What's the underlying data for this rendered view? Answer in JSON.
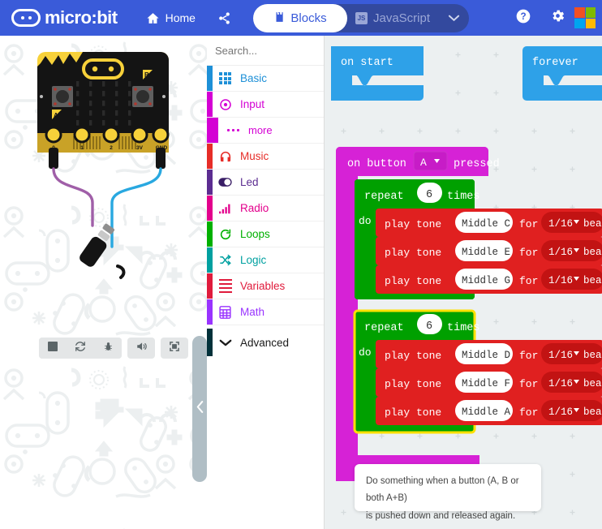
{
  "app": {
    "brand": "micro:bit",
    "brand_icon": "microbit-logo-icon"
  },
  "topbar": {
    "home_label": "Home",
    "home_icon": "home-icon",
    "share_icon": "share-icon",
    "toggle": {
      "blocks_label": "Blocks",
      "blocks_icon": "puzzle-piece-icon",
      "javascript_label": "JavaScript",
      "javascript_badge": "JS",
      "caret_icon": "chevron-down-icon",
      "selected": "Blocks"
    },
    "help_icon": "help-circle-icon",
    "settings_icon": "gear-icon",
    "ms_logo_icon": "microsoft-logo-icon",
    "ms_logo_colors": [
      "#f25022",
      "#7fba00",
      "#00a4ef",
      "#ffb900"
    ],
    "background": "#3a5bd9"
  },
  "simulator": {
    "device": "micro:bit board",
    "pin_labels": [
      "0",
      "1",
      "2",
      "3V",
      "GND"
    ],
    "accessory": "headphone-jack-with-wires",
    "wire_colors": [
      "#a05fa8",
      "#29a8e0"
    ],
    "toolbar": [
      {
        "name": "stop-button",
        "icon": "stop-square-icon"
      },
      {
        "name": "restart-button",
        "icon": "refresh-icon"
      },
      {
        "name": "debug-button",
        "icon": "bug-icon"
      },
      {
        "name": "mute-button",
        "icon": "speaker-icon"
      },
      {
        "name": "fullscreen-button",
        "icon": "fullscreen-icon"
      }
    ],
    "collapse_handle_icon": "chevron-left-icon"
  },
  "toolbox": {
    "search": {
      "placeholder": "Search...",
      "value": "",
      "icon": "search-icon"
    },
    "categories": [
      {
        "label": "Basic",
        "color": "#1e90d7",
        "icon": "grid-dots-icon",
        "sub": false
      },
      {
        "label": "Input",
        "color": "#d400d4",
        "icon": "target-icon",
        "sub": false
      },
      {
        "label": "more",
        "color": "#d400d4",
        "icon": "ellipsis-icon",
        "sub": true
      },
      {
        "label": "Music",
        "color": "#e62d28",
        "icon": "headphones-icon",
        "sub": false
      },
      {
        "label": "Led",
        "color": "#5c2d91",
        "icon": "toggle-icon",
        "sub": false
      },
      {
        "label": "Radio",
        "color": "#e3008c",
        "icon": "signal-bars-icon",
        "sub": false
      },
      {
        "label": "Loops",
        "color": "#00b000",
        "icon": "loop-arrow-icon",
        "sub": false
      },
      {
        "label": "Logic",
        "color": "#00a0a0",
        "icon": "shuffle-icon",
        "sub": false
      },
      {
        "label": "Variables",
        "color": "#e01b3c",
        "icon": "lines-icon",
        "sub": false
      },
      {
        "label": "Math",
        "color": "#9933ff",
        "icon": "calculator-icon",
        "sub": false
      }
    ],
    "advanced": {
      "label": "Advanced",
      "color": "#01313a",
      "icon": "chevron-down-icon"
    }
  },
  "workspace": {
    "background": "#ecf0f1",
    "blocks": {
      "on_start": {
        "label": "on start",
        "color": "#2ea1e8"
      },
      "forever": {
        "label": "forever",
        "color": "#2ea1e8"
      },
      "event": {
        "color": "#d622d6",
        "prefix": "on button",
        "button_value": "A",
        "suffix": "pressed",
        "dropdown_icon": "caret-down-icon"
      },
      "loops": [
        {
          "color": "#00a000",
          "selected": false,
          "repeat_label": "repeat",
          "count": "6",
          "times_label": "times",
          "do_label": "do",
          "statements": [
            {
              "color": "#e02020",
              "prefix": "play tone",
              "note": "Middle C",
              "mid": "for",
              "duration": "1/16",
              "suffix": "beat",
              "dropdown_icon": "caret-down-icon"
            },
            {
              "color": "#e02020",
              "prefix": "play tone",
              "note": "Middle E",
              "mid": "for",
              "duration": "1/16",
              "suffix": "beat",
              "dropdown_icon": "caret-down-icon"
            },
            {
              "color": "#e02020",
              "prefix": "play tone",
              "note": "Middle G",
              "mid": "for",
              "duration": "1/16",
              "suffix": "beat",
              "dropdown_icon": "caret-down-icon"
            }
          ]
        },
        {
          "color": "#00a000",
          "selected": true,
          "highlight": "#ffe000",
          "repeat_label": "repeat",
          "count": "6",
          "times_label": "times",
          "do_label": "do",
          "statements": [
            {
              "color": "#e02020",
              "prefix": "play tone",
              "note": "Middle D",
              "mid": "for",
              "duration": "1/16",
              "suffix": "beat",
              "dropdown_icon": "caret-down-icon"
            },
            {
              "color": "#e02020",
              "prefix": "play tone",
              "note": "Middle F",
              "mid": "for",
              "duration": "1/16",
              "suffix": "beat",
              "dropdown_icon": "caret-down-icon"
            },
            {
              "color": "#e02020",
              "prefix": "play tone",
              "note": "Middle A",
              "mid": "for",
              "duration": "1/16",
              "suffix": "beat",
              "dropdown_icon": "caret-down-icon"
            }
          ]
        }
      ]
    },
    "tooltip": {
      "line1": "Do something when a button (A, B or both A+B)",
      "line2": "is pushed down and released again."
    }
  }
}
